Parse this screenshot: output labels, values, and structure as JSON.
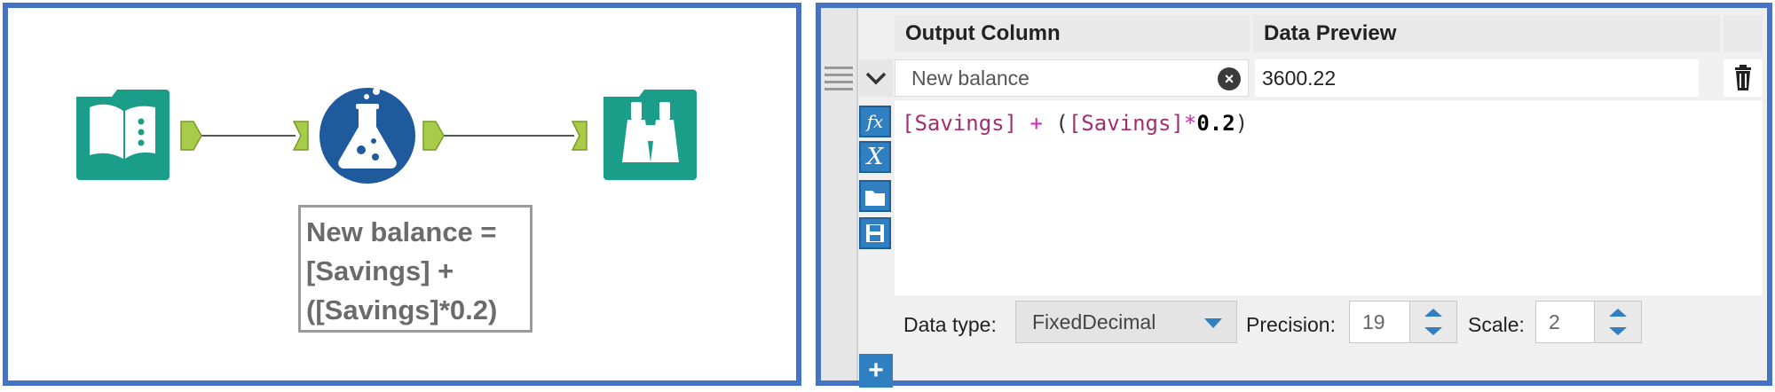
{
  "workflow": {
    "annotation_lines": [
      "New balance =",
      "[Savings] +",
      "([Savings]*0.2)"
    ],
    "tools": [
      {
        "name": "input-data-tool",
        "color": "#1a9e8a"
      },
      {
        "name": "formula-tool",
        "color": "#1f5a9c"
      },
      {
        "name": "browse-tool",
        "color": "#1a9e8a"
      }
    ],
    "connector_color": "#a8cc4a",
    "border_color": "#4472c4"
  },
  "formula_config": {
    "headers": {
      "output_column": "Output Column",
      "data_preview": "Data Preview"
    },
    "output_field": {
      "value": "New balance"
    },
    "preview_value": "3600.22",
    "expression": {
      "tokens": [
        {
          "text": "[Savings]",
          "kind": "field"
        },
        {
          "text": " ",
          "kind": "punc"
        },
        {
          "text": "+",
          "kind": "op"
        },
        {
          "text": " (",
          "kind": "punc"
        },
        {
          "text": "[Savings]",
          "kind": "field"
        },
        {
          "text": "*",
          "kind": "op"
        },
        {
          "text": "0.2",
          "kind": "num"
        },
        {
          "text": ")",
          "kind": "punc"
        }
      ]
    },
    "side_buttons": [
      {
        "name": "functions-icon",
        "glyph": "fx"
      },
      {
        "name": "variables-icon",
        "glyph": "X"
      },
      {
        "name": "open-expression-icon",
        "glyph": "folder"
      },
      {
        "name": "save-expression-icon",
        "glyph": "save"
      }
    ],
    "data_type": {
      "label": "Data type:",
      "value": "FixedDecimal"
    },
    "precision": {
      "label": "Precision:",
      "value": "19"
    },
    "scale": {
      "label": "Scale:",
      "value": "2"
    },
    "add_label": "+"
  }
}
